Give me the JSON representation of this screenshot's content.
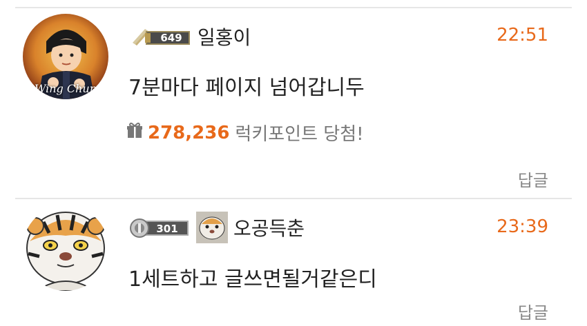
{
  "comments": [
    {
      "level_badge": "649",
      "nickname": "일홍이",
      "time": "22:51",
      "text": "7분마다 페이지 넘어갑니두",
      "lucky": {
        "icon": "gift-icon",
        "amount": "278,236",
        "label": "럭키포인트 당첨!"
      },
      "reply_label": "답글",
      "avatar_caption": "Wing Chun"
    },
    {
      "level_badge": "301",
      "nickname": "오공득춘",
      "time": "23:39",
      "text": "1세트하고 글쓰면될거같은디",
      "reply_label": "답글"
    }
  ],
  "colors": {
    "accent": "#e8691a",
    "divider": "#e6e6e6",
    "muted": "#888888"
  }
}
